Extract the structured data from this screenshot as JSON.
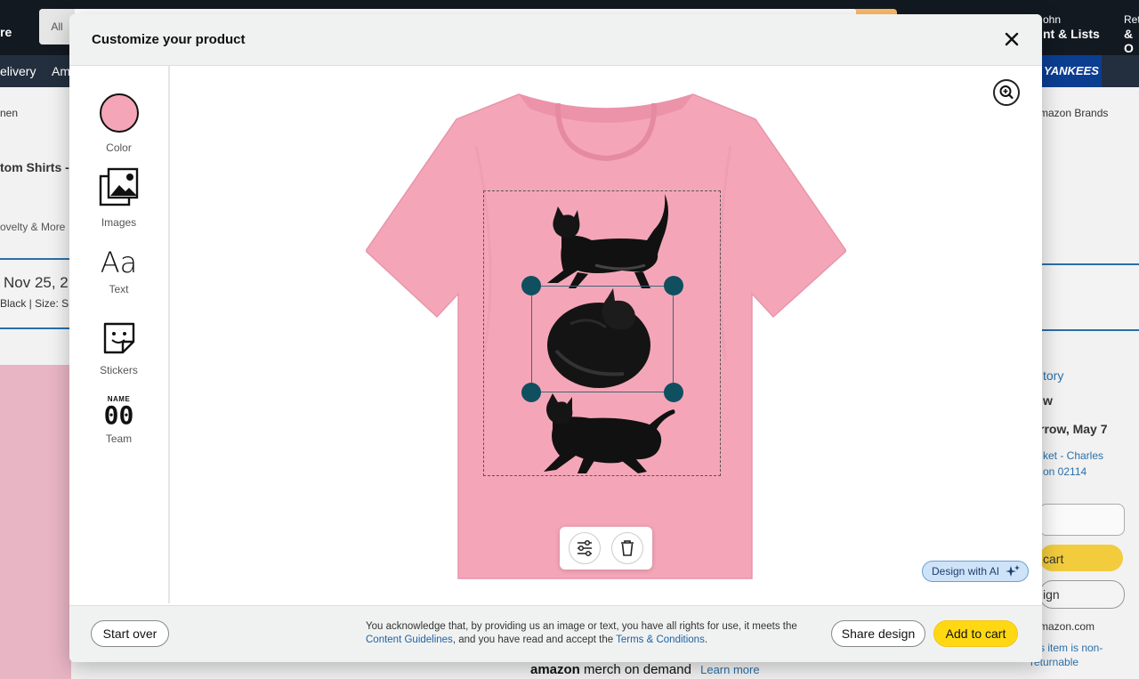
{
  "background": {
    "search_scope": "All",
    "store_fragment": "re",
    "account_greeting": "ohn",
    "account_menu": "nt & Lists",
    "returns_small": "Ret",
    "returns_big": "& O",
    "subnav_delivery": "elivery",
    "subnav_am": "Am",
    "yankees_label": "YANKEES",
    "breadcrumb_left": "nen",
    "breadcrumb_right": "mazon Brands",
    "product_title_fragment": "tom Shirts -",
    "category_fragment": "ovelty & More",
    "date_fragment": "Nov 25, 2",
    "variant_fragment": "Black | Size: Sm",
    "history_link": "tory",
    "now_text": "w",
    "delivery_text": "rrow, May 7",
    "location_line1": "ket - Charles",
    "location_line2": "on 02114",
    "cart_fragment": "cart",
    "sign_fragment": "ign",
    "amazon_com": "mazon.com",
    "return_line1": "s item is non-",
    "return_line2": "returnable",
    "merch_amazon": "amazon",
    "merch_text": "merch on demand",
    "learn_more": "Learn more"
  },
  "modal": {
    "title": "Customize your product",
    "close_label": "×",
    "tools": [
      {
        "label": "Color",
        "swatch_color": "#f4a6b8"
      },
      {
        "label": "Images"
      },
      {
        "label": "Text",
        "glyph": "Aa"
      },
      {
        "label": "Stickers"
      },
      {
        "label": "Team",
        "jersey_name": "NAME",
        "jersey_number": "00"
      }
    ],
    "design_ai_label": "Design with AI",
    "footer": {
      "start_over": "Start over",
      "ack_pre": "You acknowledge that, by providing us an image or text, you have all rights for use, it meets the ",
      "content_guidelines": "Content Guidelines",
      "ack_mid": ", and you have read and accept the ",
      "terms": "Terms & Conditions",
      "ack_post": ".",
      "share_design": "Share design",
      "add_to_cart": "Add to cart"
    }
  },
  "colors": {
    "shirt": "#f4a6b8",
    "handle": "#0f4f60",
    "cart_button": "#ffd814",
    "link": "#2162a1"
  },
  "icons": {
    "close": "close-icon",
    "zoom": "zoom-in-icon",
    "adjust": "sliders-icon",
    "delete": "trash-icon",
    "ai": "sparkle-icon"
  }
}
